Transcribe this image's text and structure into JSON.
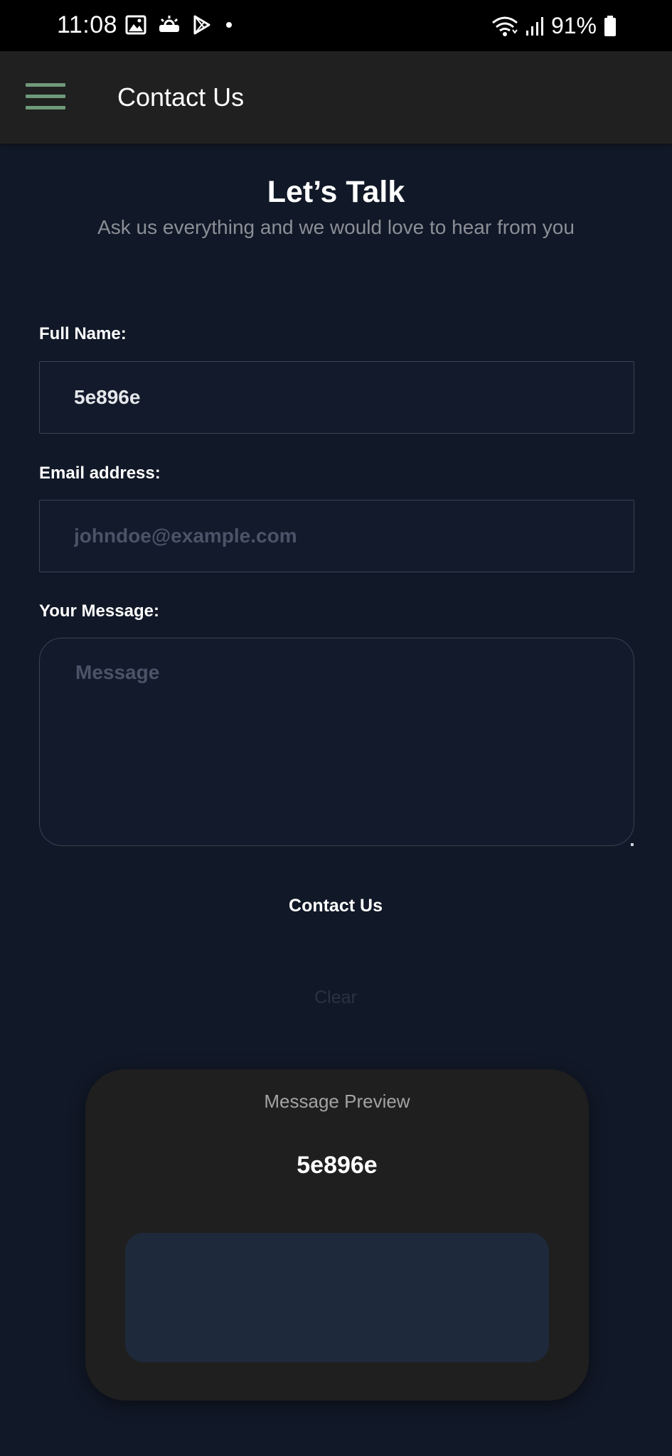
{
  "status_bar": {
    "time": "11:08",
    "battery": "91%",
    "icons_left": [
      "gallery-icon",
      "weather-icon",
      "play-store-icon",
      "notification-dot"
    ],
    "icons_right": [
      "wifi-icon",
      "signal-icon",
      "battery-icon"
    ]
  },
  "app_bar": {
    "title": "Contact Us",
    "menu_icon": "hamburger-menu-icon",
    "accent_color": "#6f9a7a"
  },
  "hero": {
    "title": "Let’s Talk",
    "subtitle": "Ask us everything and we would love to hear from you"
  },
  "form": {
    "name_label": "Full Name:",
    "name_value": "5e896e",
    "email_label": "Email address:",
    "email_value": "",
    "email_placeholder": "johndoe@example.com",
    "message_label": "Your Message:",
    "message_value": "",
    "message_placeholder": "Message",
    "submit_label": "Contact Us",
    "clear_label": "Clear"
  },
  "preview": {
    "label": "Message Preview",
    "name": "5e896e",
    "message": ""
  },
  "colors": {
    "background": "#111827",
    "app_bar": "#202020",
    "card": "#1f1f1f",
    "preview_box": "#1e293b"
  }
}
